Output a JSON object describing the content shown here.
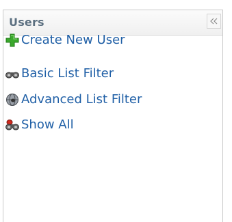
{
  "panel": {
    "title": "Users",
    "collapse_icon": "double-chevron-left-icon"
  },
  "menu": {
    "items": [
      {
        "label": "Create New User",
        "icon": "add-plus-icon"
      },
      {
        "label": "Basic List Filter",
        "icon": "binoculars-icon"
      },
      {
        "label": "Advanced List Filter",
        "icon": "globe-filter-icon"
      },
      {
        "label": "Show All",
        "icon": "binoculars-red-icon"
      }
    ]
  },
  "colors": {
    "title": "#5b6f80",
    "link": "#1f5fa6",
    "border": "#c8c8c8",
    "plus_green": "#3aa82c"
  }
}
